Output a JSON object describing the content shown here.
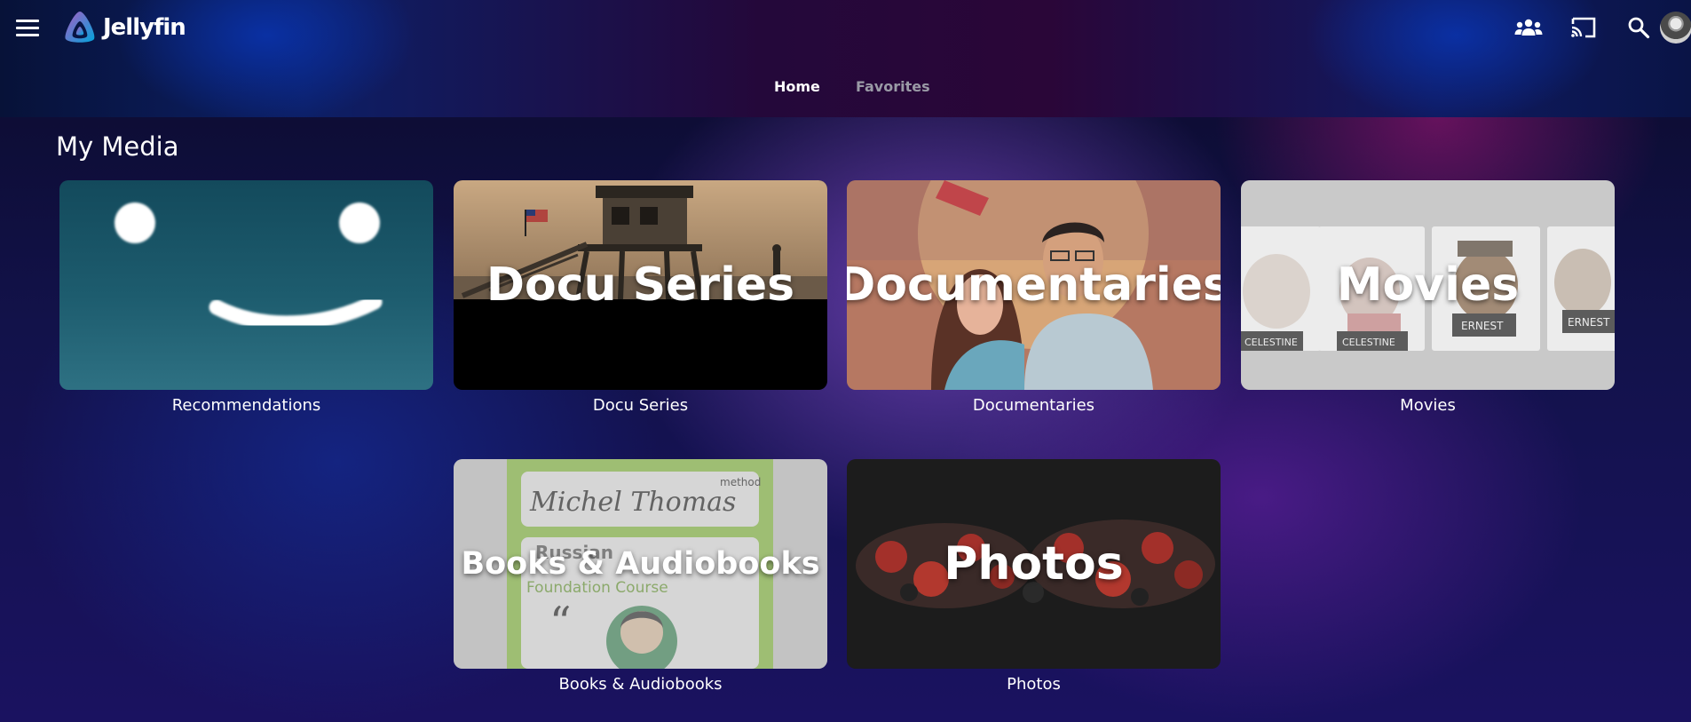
{
  "app": {
    "name": "Jellyfin"
  },
  "header": {
    "menu_icon": "hamburger-menu-icon",
    "icons": [
      "users-icon",
      "cast-icon",
      "search-icon"
    ],
    "avatar": "user-avatar"
  },
  "tabs": [
    {
      "label": "Home",
      "active": true
    },
    {
      "label": "Favorites",
      "active": false
    }
  ],
  "section": {
    "title": "My Media"
  },
  "libraries": [
    {
      "label": "Recommendations",
      "overlay": ""
    },
    {
      "label": "Docu Series",
      "overlay": "Docu Series"
    },
    {
      "label": "Documentaries",
      "overlay": "Documentaries"
    },
    {
      "label": "Movies",
      "overlay": "Movies"
    },
    {
      "label": "Books & Audiobooks",
      "overlay": "Books & Audiobooks"
    },
    {
      "label": "Photos",
      "overlay": "Photos"
    }
  ],
  "artwork_text": {
    "book_title": "Michel Thomas",
    "book_method": "method",
    "book_subtitle": "Foundation Course",
    "book_language": "Russian",
    "movie_sign_1": "CELESTINE",
    "movie_sign_2": "ERNEST"
  },
  "colors": {
    "active_tab": "#ffffff",
    "inactive_tab": "#9a9aa6",
    "logo_start": "#aa5cc3",
    "logo_end": "#00a4dc"
  }
}
